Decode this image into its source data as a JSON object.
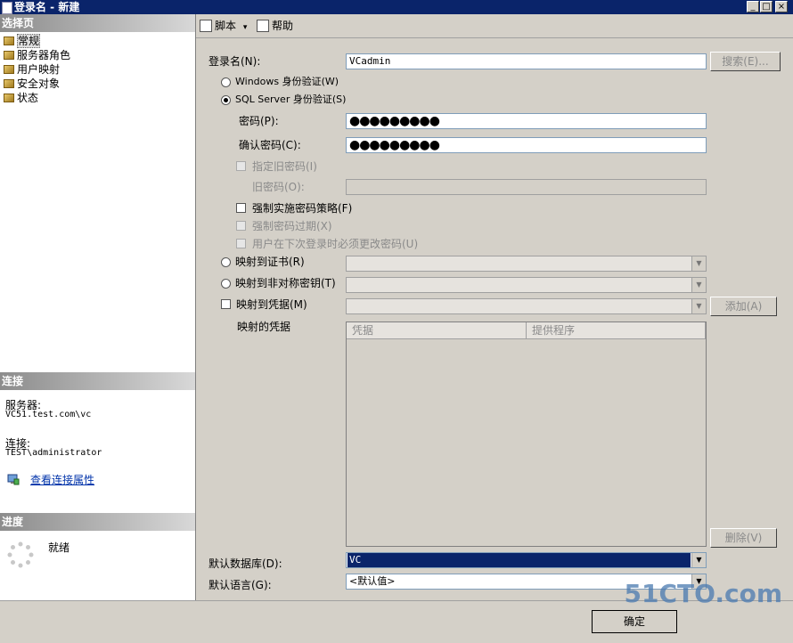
{
  "window": {
    "title": "登录名 - 新建",
    "min_btn": "_",
    "max_btn": "□",
    "close_btn": "×"
  },
  "left": {
    "select_page_header": "选择页",
    "nav_items": [
      "常规",
      "服务器角色",
      "用户映射",
      "安全对象",
      "状态"
    ],
    "connection_header": "连接",
    "server_label": "服务器:",
    "server_value": "VC51.test.com\\vc",
    "connection_label": "连接:",
    "connection_value": "TEST\\administrator",
    "view_props_link": "查看连接属性",
    "progress_header": "进度",
    "progress_status": "就绪"
  },
  "toolbar": {
    "script_label": "脚本",
    "script_arrow": "▾",
    "help_label": "帮助"
  },
  "form": {
    "login_name_label": "登录名(N):",
    "login_name_value": "VCadmin",
    "search_button": "搜索(E)...",
    "windows_auth_label": "Windows 身份验证(W)",
    "sql_auth_label": "SQL Server 身份验证(S)",
    "password_label": "密码(P):",
    "password_value": "●●●●●●●●●",
    "confirm_password_label": "确认密码(C):",
    "confirm_password_value": "●●●●●●●●●",
    "specify_old_password_label": "指定旧密码(I)",
    "old_password_label": "旧密码(O):",
    "enforce_policy_label": "强制实施密码策略(F)",
    "enforce_expiration_label": "强制密码过期(X)",
    "must_change_label": "用户在下次登录时必须更改密码(U)",
    "map_cert_label": "映射到证书(R)",
    "map_asym_key_label": "映射到非对称密钥(T)",
    "map_credential_label": "映射到凭据(M)",
    "add_button": "添加(A)",
    "mapped_credentials_label": "映射的凭据",
    "grid_columns": [
      "凭据",
      "提供程序"
    ],
    "remove_button": "删除(V)",
    "default_db_label": "默认数据库(D):",
    "default_db_value": "VC",
    "default_lang_label": "默认语言(G):",
    "default_lang_value": "<默认值>"
  },
  "footer": {
    "ok_button": "确定",
    "watermark": "51CTO.com"
  }
}
